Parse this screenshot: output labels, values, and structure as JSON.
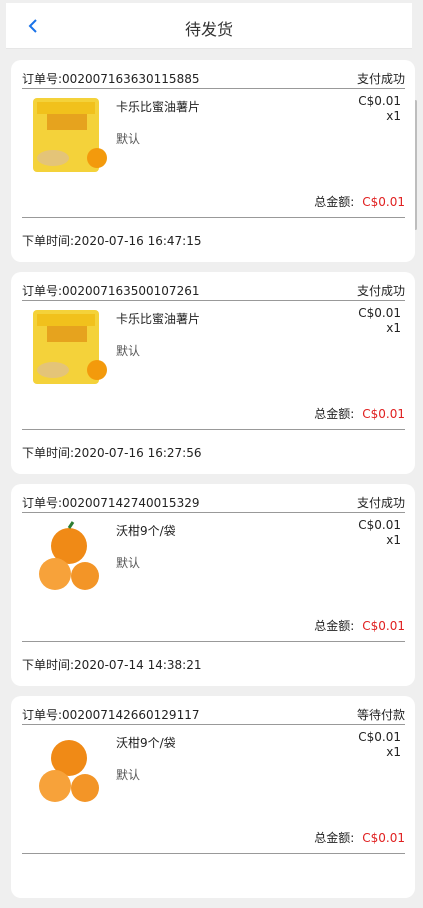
{
  "header": {
    "title": "待发货",
    "back_icon": "chevron-left-icon"
  },
  "orders": [
    {
      "order_no": "订单号:002007163630115885",
      "status": "支付成功",
      "product": "卡乐比蜜油薯片",
      "spec": "默认",
      "price": "C$0.01",
      "qty": "x1",
      "total_label": "总金额:",
      "total": "C$0.01",
      "time": "下单时间:2020-07-16 16:47:15",
      "image": "potato-chips-bag"
    },
    {
      "order_no": "订单号:002007163500107261",
      "status": "支付成功",
      "product": "卡乐比蜜油薯片",
      "spec": "默认",
      "price": "C$0.01",
      "qty": "x1",
      "total_label": "总金额:",
      "total": "C$0.01",
      "time": "下单时间:2020-07-16 16:27:56",
      "image": "potato-chips-bag"
    },
    {
      "order_no": "订单号:002007142740015329",
      "status": "支付成功",
      "product": "沃柑9个/袋",
      "spec": "默认",
      "price": "C$0.01",
      "qty": "x1",
      "total_label": "总金额:",
      "total": "C$0.01",
      "time": "下单时间:2020-07-14 14:38:21",
      "image": "mandarin-oranges"
    },
    {
      "order_no": "订单号:002007142660129117",
      "status": "等待付款",
      "product": "沃柑9个/袋",
      "spec": "默认",
      "price": "C$0.01",
      "qty": "x1",
      "total_label": "总金额:",
      "total": "C$0.01",
      "time": "",
      "image": "mandarin-oranges"
    }
  ],
  "colors": {
    "accent": "#1a73e8",
    "price_red": "#e02020",
    "bg": "#efefef"
  }
}
